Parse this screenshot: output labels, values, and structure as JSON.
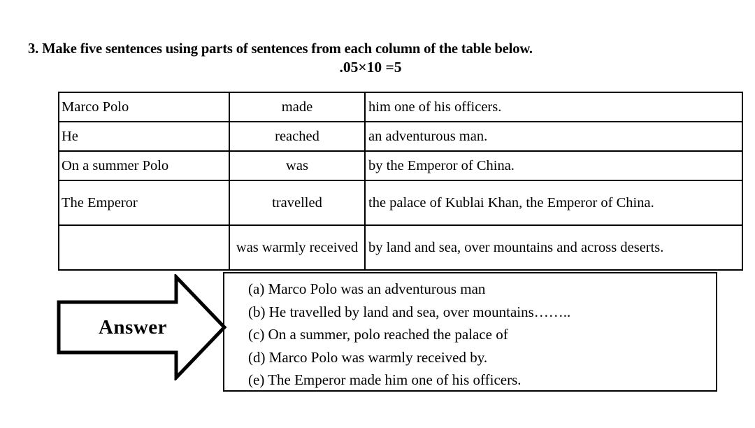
{
  "question": {
    "number_and_prompt": "3. Make five sentences using parts of sentences from each column of the table below.",
    "marks": ".05×10 =5"
  },
  "table": {
    "rows": [
      {
        "subject": "Marco Polo",
        "verb": "made",
        "object": "him one of his officers."
      },
      {
        "subject": "He",
        "verb": "reached",
        "object": "an adventurous man."
      },
      {
        "subject": "On a summer Polo",
        "verb": "was",
        "object": "by the Emperor of China."
      },
      {
        "subject": "The Emperor",
        "verb": "travelled",
        "object": "the palace of Kublai Khan, the Emperor of China."
      },
      {
        "subject": "",
        "verb": "was warmly received",
        "object": "by land and sea, over mountains and across deserts."
      }
    ]
  },
  "answer": {
    "arrow_label": "Answer",
    "lines": [
      "(a) Marco Polo was an adventurous man",
      "(b) He travelled by land and sea, over mountains……..",
      "(c) On a summer, polo reached the palace of",
      "(d) Marco Polo was warmly received by.",
      "(e) The Emperor made him one of his officers."
    ]
  },
  "colors": {
    "ink": "#000000",
    "paper": "#ffffff"
  }
}
